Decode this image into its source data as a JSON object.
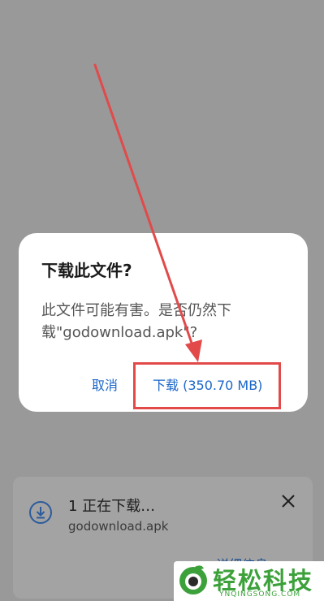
{
  "dialog": {
    "title": "下载此文件?",
    "message": "此文件可能有害。是否仍然下载\"godownload.apk\"?",
    "cancel_label": "取消",
    "download_label": "下载 (350.70 MB)"
  },
  "notification": {
    "title": "1 正在下载…",
    "filename": "godownload.apk",
    "details_label": "详细信息",
    "icons": [
      "download-icon",
      "close-icon"
    ]
  },
  "watermark": {
    "brand": "轻松科技",
    "site": "YNQINGSONG.COM"
  },
  "colors": {
    "accent": "#1a66c9",
    "highlight": "#e24a4a",
    "watermark": "#3ca13a"
  }
}
